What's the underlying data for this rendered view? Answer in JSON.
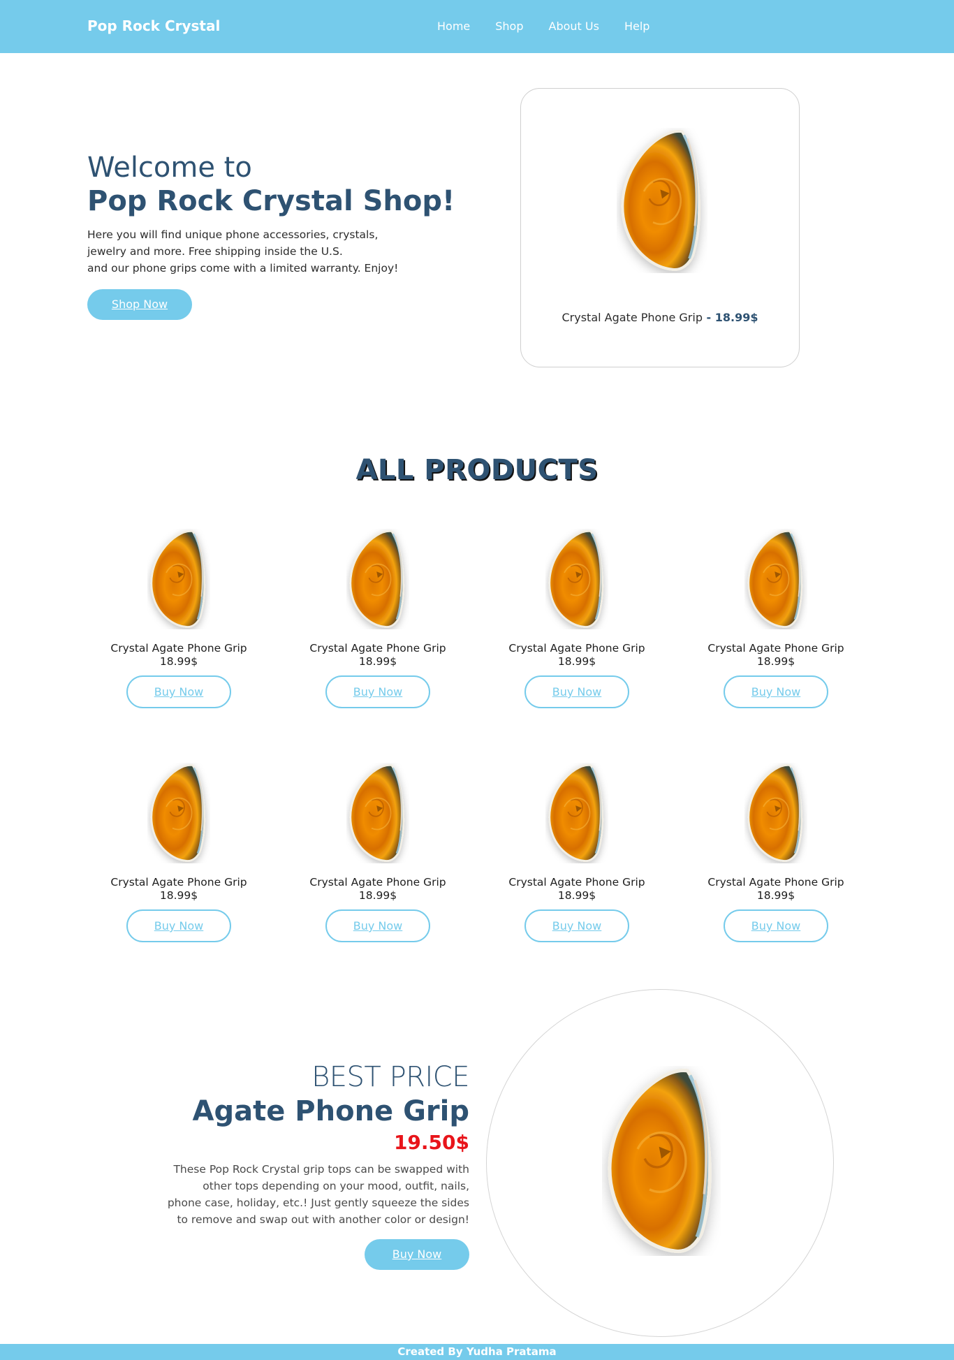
{
  "nav": {
    "brand": "Pop Rock Crystal",
    "links": [
      "Home",
      "Shop",
      "About Us",
      "Help"
    ]
  },
  "hero": {
    "welcome": "Welcome to",
    "title": "Pop Rock Crystal Shop!",
    "desc_lines": [
      "Here you will find unique phone accessories, crystals,",
      "jewelry and more. Free shipping inside the U.S.",
      "and our phone grips come with a limited warranty. Enjoy!"
    ],
    "button": "Shop Now",
    "card_product": "Crystal Agate Phone Grip",
    "card_separator": " - ",
    "card_price": "18.99$"
  },
  "products": {
    "title": "ALL PRODUCTS",
    "items": [
      {
        "name": "Crystal Agate Phone Grip",
        "price": "18.99$",
        "button": "Buy Now"
      },
      {
        "name": "Crystal Agate Phone Grip",
        "price": "18.99$",
        "button": "Buy Now"
      },
      {
        "name": "Crystal Agate Phone Grip",
        "price": "18.99$",
        "button": "Buy Now"
      },
      {
        "name": "Crystal Agate Phone Grip",
        "price": "18.99$",
        "button": "Buy Now"
      },
      {
        "name": "Crystal Agate Phone Grip",
        "price": "18.99$",
        "button": "Buy Now"
      },
      {
        "name": "Crystal Agate Phone Grip",
        "price": "18.99$",
        "button": "Buy Now"
      },
      {
        "name": "Crystal Agate Phone Grip",
        "price": "18.99$",
        "button": "Buy Now"
      },
      {
        "name": "Crystal Agate Phone Grip",
        "price": "18.99$",
        "button": "Buy Now"
      }
    ]
  },
  "best": {
    "label": "BEST PRICE",
    "title": "Agate Phone Grip",
    "price": "19.50$",
    "desc_lines": [
      "These Pop Rock Crystal grip tops can be swapped with",
      "other tops depending on your mood, outfit, nails,",
      "phone case, holiday, etc.! Just gently squeeze the sides",
      "to remove and swap out with another color or design!"
    ],
    "button": "Buy Now"
  },
  "footer": {
    "text": "Created By Yudha Pratama"
  },
  "colors": {
    "accent": "#75cbeb",
    "heading": "#2e5272",
    "price_red": "#e8141a"
  },
  "icons": {
    "product_image": "agate-crystal-image"
  }
}
